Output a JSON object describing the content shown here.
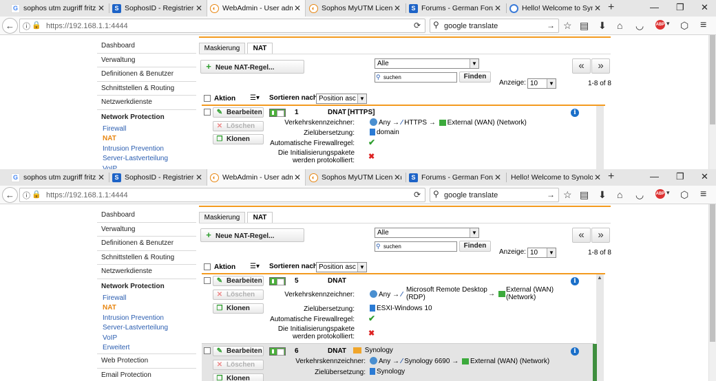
{
  "tabs": [
    {
      "title": "sophos utm zugriff fritzb",
      "icon": "google-icon"
    },
    {
      "title": "SophosID - Registrieren",
      "icon": "sophos-icon"
    },
    {
      "title": "WebAdmin - User admi",
      "icon": "webadmin-icon"
    },
    {
      "title": "Sophos MyUTM Licensi",
      "icon": "webadmin-icon"
    },
    {
      "title": "Forums - German Forum",
      "icon": "sophos-icon"
    },
    {
      "title": "Hello! Welcome to Synol",
      "icon": "synology-icon"
    }
  ],
  "tabs2": [
    {
      "title": "sophos utm zugriff fritzb"
    },
    {
      "title": "SophosID - Registrieren"
    },
    {
      "title": "WebAdmin - User admi"
    },
    {
      "title": "Sophos MyUTM Licensin"
    },
    {
      "title": "Forums - German Forum"
    },
    {
      "title": "Hello! Welcome to Synology"
    }
  ],
  "toolbar": {
    "url_host": "https://192.168.1.1",
    "url_port": ":4444",
    "search_text": "google translate",
    "abp": "ABP"
  },
  "sidebar": {
    "items": [
      "Dashboard",
      "Verwaltung",
      "Definitionen & Benutzer",
      "Schnittstellen & Routing",
      "Netzwerkdienste"
    ],
    "section": "Network Protection",
    "subitems": [
      "Firewall",
      "NAT",
      "Intrusion Prevention",
      "Server-Lastverteilung",
      "VoIP",
      "Erweitert"
    ],
    "after": [
      "Web Protection",
      "Email Protection"
    ]
  },
  "subtabs": [
    "Maskierung",
    "NAT"
  ],
  "controls": {
    "new_rule": "Neue NAT-Regel...",
    "filter_value": "Alle",
    "search_placeholder": "suchen",
    "find": "Finden",
    "show_label": "Anzeige:",
    "show_value": "10",
    "range": "1-8 of 8",
    "prev": "«",
    "next": "»"
  },
  "listhead": {
    "action": "Aktion",
    "sort_label": "Sortieren nach:",
    "sort_value": "Position asc"
  },
  "labels": {
    "edit": "Bearbeiten",
    "delete": "Löschen",
    "clone": "Klonen",
    "traffic": "Verkehrskennzeichner:",
    "target": "Zielübersetzung:",
    "autofw": "Automatische Firewallregel:",
    "logged": "Die Initialisierungspakete",
    "logged2": "werden protokolliert:",
    "arrow": "→"
  },
  "rule1": {
    "num": "1",
    "type": "DNAT",
    "title": "[HTTPS]",
    "src": "Any",
    "svc": "HTTPS",
    "dst": "External (WAN) (Network)",
    "target": "domain",
    "autofw": "✔",
    "logged": "✖"
  },
  "rule5": {
    "num": "5",
    "type": "DNAT",
    "src": "Any",
    "svc": "Microsoft Remote Desktop",
    "svc2": "(RDP)",
    "dst": "External (WAN)",
    "dst2": "(Network)",
    "target": "ESXI-Windows 10",
    "autofw": "✔",
    "logged": "✖"
  },
  "rule6": {
    "num": "6",
    "type": "DNAT",
    "title": "Synology",
    "src": "Any",
    "svc": "Synology 6690",
    "dst": "External (WAN) (Network)",
    "target": "Synology"
  },
  "colors": {
    "accent": "#f39a1e",
    "link": "#2a5db0",
    "active": "#e8850f",
    "on": "#4caf3c"
  }
}
